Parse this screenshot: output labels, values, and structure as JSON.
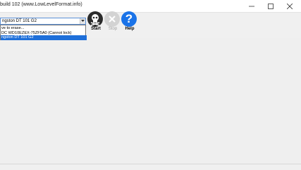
{
  "window": {
    "title": "build 102 (www.LowLevelFormat.info)",
    "controls": [
      "minimize-icon",
      "maximize-icon",
      "close-icon"
    ]
  },
  "drive_select": {
    "selected": "ngston DT 101 G2",
    "options": [
      "ve to erase...",
      "DC WD10EZEX-75ZF5A0 (Cannot lock)",
      "ngston DT 101 G2"
    ]
  },
  "toolbar": {
    "start_label": "Start",
    "stop_label": "Stop",
    "help_label": "Help",
    "help_glyph": "?"
  },
  "colors": {
    "accent": "#1e6fd9",
    "help_blue": "#1a73e8",
    "start_dark": "#2b2b2b",
    "stop_disabled": "#d3d3d3"
  }
}
